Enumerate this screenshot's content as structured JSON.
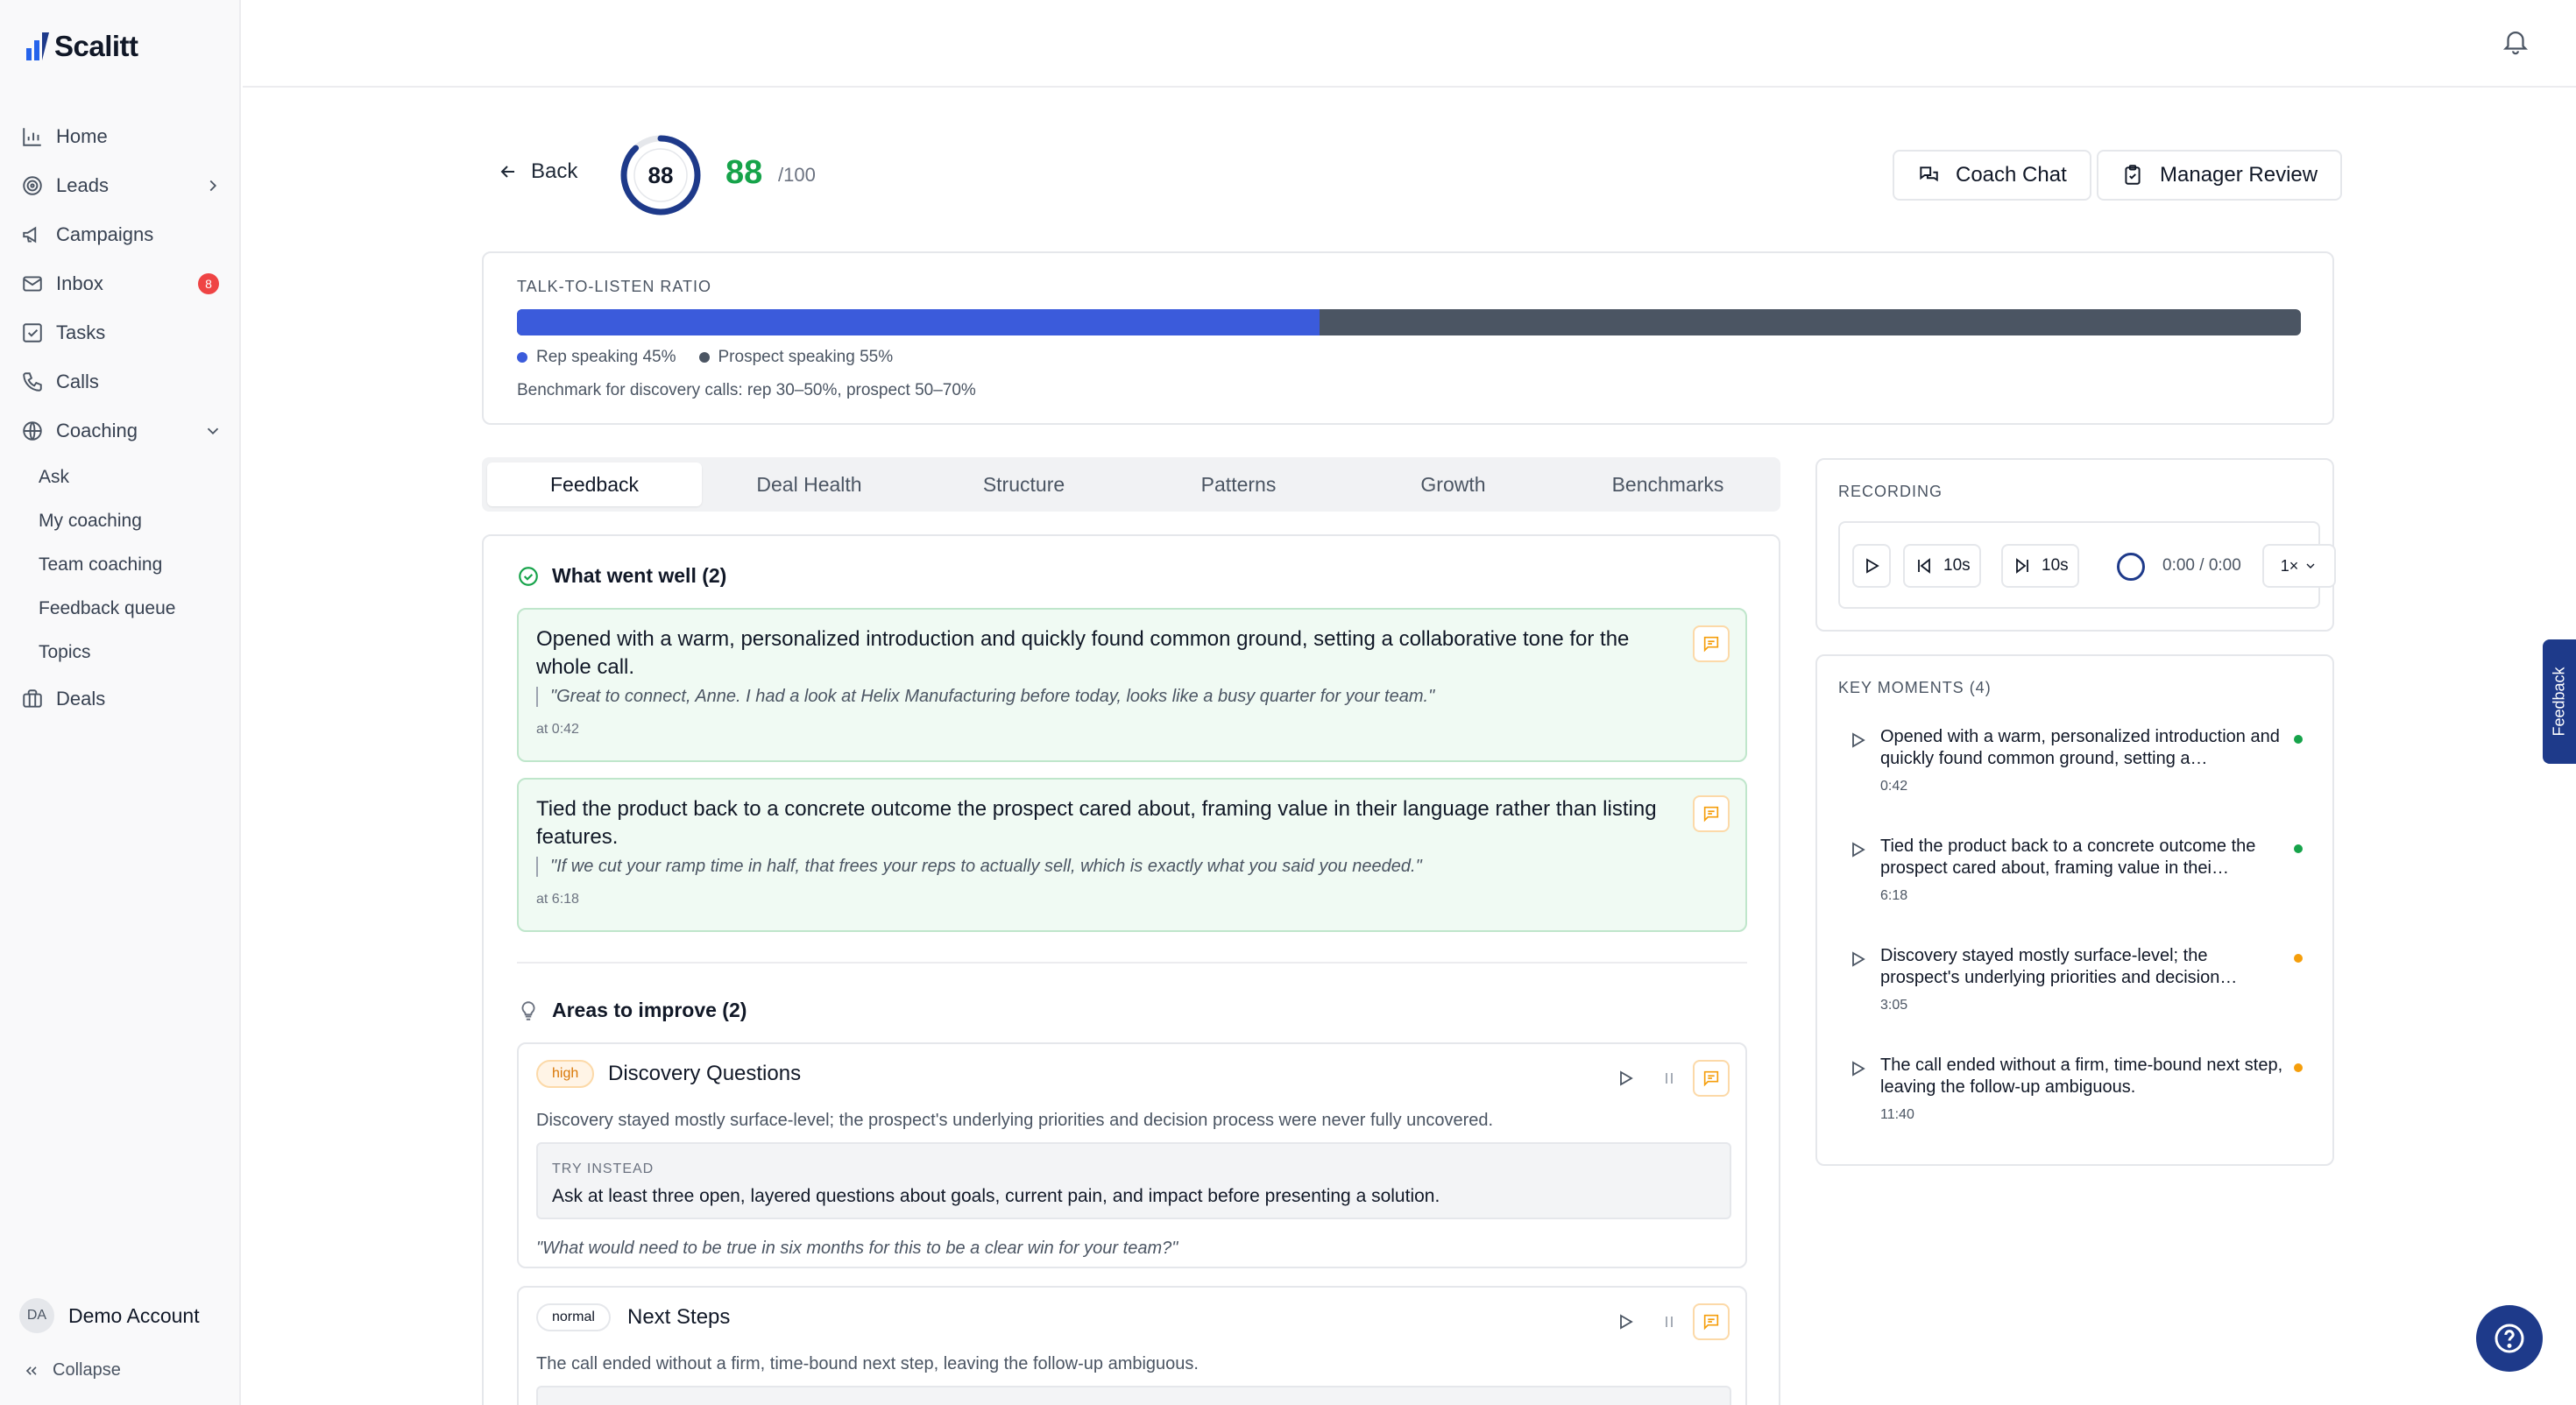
{
  "app": {
    "name": "Scalitt"
  },
  "sidebar": {
    "items": [
      {
        "label": "Home",
        "icon": "bar-chart-icon"
      },
      {
        "label": "Leads",
        "icon": "target-icon"
      },
      {
        "label": "Campaigns",
        "icon": "megaphone-icon"
      },
      {
        "label": "Inbox",
        "icon": "mail-icon",
        "badge": "8"
      },
      {
        "label": "Tasks",
        "icon": "checkbox-icon"
      },
      {
        "label": "Calls",
        "icon": "phone-icon"
      },
      {
        "label": "Coaching",
        "icon": "globe-icon"
      },
      {
        "label": "Deals",
        "icon": "briefcase-icon"
      }
    ],
    "coaching_sub": [
      "Ask",
      "My coaching",
      "Team coaching",
      "Feedback queue",
      "Topics"
    ],
    "account": {
      "initials": "DA",
      "name": "Demo Account"
    },
    "collapse_label": "Collapse"
  },
  "header": {
    "back_label": "Back",
    "score_ring": "88",
    "score": "88",
    "score_max": "/100",
    "score_fraction": 0.88,
    "coach_chat_label": "Coach Chat",
    "manager_review_label": "Manager Review"
  },
  "ratio": {
    "title": "TALK-TO-LISTEN RATIO",
    "rep_percent": 45,
    "rep_label": "Rep speaking 45%",
    "prospect_label": "Prospect speaking 55%",
    "benchmark": "Benchmark for discovery calls: rep 30–50%, prospect 50–70%",
    "colors": {
      "rep": "#3b5bdb",
      "prospect": "#4b5563"
    }
  },
  "tabs": [
    "Feedback",
    "Deal Health",
    "Structure",
    "Patterns",
    "Growth",
    "Benchmarks"
  ],
  "feedback": {
    "well_title": "What went well (2)",
    "well": [
      {
        "text": "Opened with a warm, personalized introduction and quickly found common ground, setting a collaborative tone for the whole call.",
        "quote": "\"Great to connect, Anne. I had a look at Helix Manufacturing before today, looks like a busy quarter for your team.\"",
        "at": "at 0:42"
      },
      {
        "text": "Tied the product back to a concrete outcome the prospect cared about, framing value in their language rather than listing features.",
        "quote": "\"If we cut your ramp time in half, that frees your reps to actually sell, which is exactly what you said you needed.\"",
        "at": "at 6:18"
      }
    ],
    "improve_title": "Areas to improve (2)",
    "improve": [
      {
        "priority": "high",
        "title": "Discovery Questions",
        "desc": "Discovery stayed mostly surface-level; the prospect's underlying priorities and decision process were never fully uncovered.",
        "try_label": "TRY INSTEAD",
        "try_text": "Ask at least three open, layered questions about goals, current pain, and impact before presenting a solution.",
        "quote": "\"What would need to be true in six months for this to be a clear win for your team?\""
      },
      {
        "priority": "normal",
        "title": "Next Steps",
        "desc": "The call ended without a firm, time-bound next step, leaving the follow-up ambiguous."
      }
    ]
  },
  "recording": {
    "title": "RECORDING",
    "back_label": "10s",
    "forward_label": "10s",
    "time": "0:00 / 0:00",
    "speed": "1×"
  },
  "key_moments": {
    "title": "KEY MOMENTS (4)",
    "items": [
      {
        "text": "Opened with a warm, personalized introduction and quickly found common ground, setting a…",
        "time": "0:42",
        "color": "#16a34a"
      },
      {
        "text": "Tied the product back to a concrete outcome the prospect cared about, framing value in thei…",
        "time": "6:18",
        "color": "#16a34a"
      },
      {
        "text": "Discovery stayed mostly surface-level; the prospect's underlying priorities and decision…",
        "time": "3:05",
        "color": "#f59e0b"
      },
      {
        "text": "The call ended without a firm, time-bound next step, leaving the follow-up ambiguous.",
        "time": "11:40",
        "color": "#f59e0b"
      }
    ]
  },
  "feedback_tab_label": "Feedback"
}
